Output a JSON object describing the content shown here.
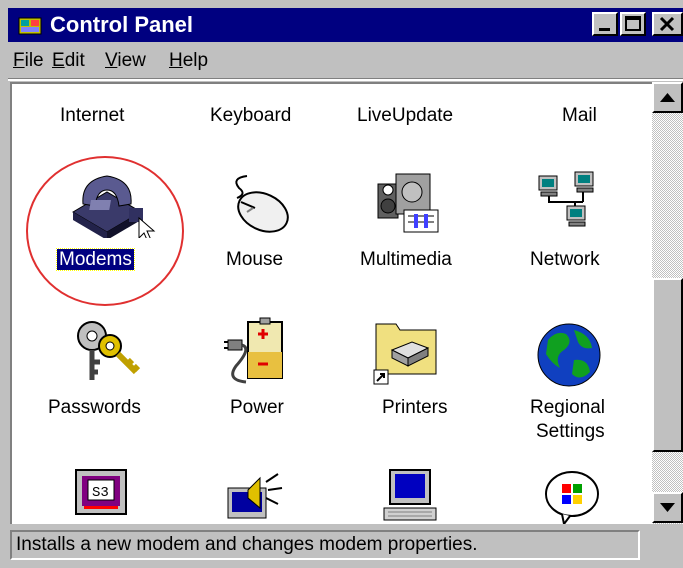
{
  "window": {
    "title": "Control Panel"
  },
  "menu": [
    {
      "label": "File",
      "accel": "F"
    },
    {
      "label": "Edit",
      "accel": "E"
    },
    {
      "label": "View",
      "accel": "V"
    },
    {
      "label": "Help",
      "accel": "H"
    }
  ],
  "items": [
    {
      "label": "Internet",
      "icon": "internet-icon"
    },
    {
      "label": "Keyboard",
      "icon": "keyboard-icon"
    },
    {
      "label": "LiveUpdate",
      "icon": "liveupdate-icon"
    },
    {
      "label": "Mail",
      "icon": "mail-icon"
    },
    {
      "label": "Modems",
      "icon": "modem-phone-icon",
      "selected": true
    },
    {
      "label": "Mouse",
      "icon": "mouse-icon"
    },
    {
      "label": "Multimedia",
      "icon": "multimedia-icon"
    },
    {
      "label": "Network",
      "icon": "network-icon"
    },
    {
      "label": "Passwords",
      "icon": "keys-icon"
    },
    {
      "label": "Power",
      "icon": "power-battery-icon"
    },
    {
      "label": "Printers",
      "icon": "printer-folder-icon"
    },
    {
      "label": "Regional\nSettings",
      "label_line1": "Regional",
      "label_line2": "Settings",
      "icon": "globe-icon"
    },
    {
      "label": "",
      "icon": "display-monitor-icon"
    },
    {
      "label": "",
      "icon": "sounds-speaker-icon"
    },
    {
      "label": "",
      "icon": "system-computer-icon"
    },
    {
      "label": "",
      "icon": "windows-logo-icon"
    }
  ],
  "status": {
    "text": "Installs a new modem and changes modem properties."
  },
  "colors": {
    "titlebar": "#000080",
    "selection": "#000080",
    "highlight_circle": "#e03030",
    "face": "#c0c0c0"
  }
}
